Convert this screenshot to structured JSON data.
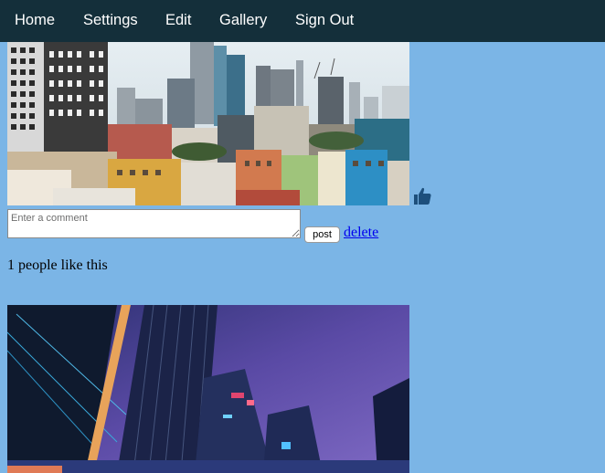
{
  "nav": {
    "items": [
      {
        "label": "Home"
      },
      {
        "label": "Settings"
      },
      {
        "label": "Edit"
      },
      {
        "label": "Gallery"
      },
      {
        "label": "Sign Out"
      }
    ]
  },
  "posts": [
    {
      "photo": "city-skyline-day-photo",
      "comment_placeholder": "Enter a comment",
      "comment_value": "",
      "post_label": "post",
      "delete_label": "delete",
      "likes_text": "1 people like this",
      "like_icon": "thumbs-up-icon"
    },
    {
      "photo": "city-night-buildings-photo"
    }
  ],
  "colors": {
    "page_background": "#7bb5e6",
    "navbar_background": "#142f3a",
    "nav_text": "#ffffff",
    "link": "#0000ee",
    "like_icon": "#1d4f7c"
  }
}
